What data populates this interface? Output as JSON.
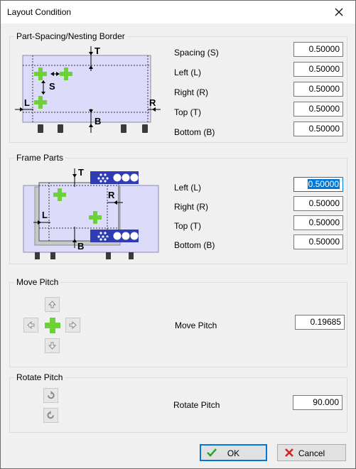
{
  "window": {
    "title": "Layout Condition"
  },
  "part_spacing": {
    "group_label": "Part-Spacing/Nesting Border",
    "fields": [
      {
        "label": "Spacing (S)",
        "value": "0.50000"
      },
      {
        "label": "Left (L)",
        "value": "0.50000"
      },
      {
        "label": "Right (R)",
        "value": "0.50000"
      },
      {
        "label": "Top (T)",
        "value": "0.50000"
      },
      {
        "label": "Bottom (B)",
        "value": "0.50000"
      }
    ],
    "diagram_labels": {
      "t": "T",
      "s": "S",
      "l": "L",
      "r": "R",
      "b": "B"
    }
  },
  "frame_parts": {
    "group_label": "Frame Parts",
    "fields": [
      {
        "label": "Left (L)",
        "value": "0.50000"
      },
      {
        "label": "Right (R)",
        "value": "0.50000"
      },
      {
        "label": "Top (T)",
        "value": "0.50000"
      },
      {
        "label": "Bottom (B)",
        "value": "0.50000"
      }
    ],
    "diagram_labels": {
      "t": "T",
      "l": "L",
      "r": "R",
      "b": "B"
    }
  },
  "move_pitch": {
    "group_label": "Move Pitch",
    "label": "Move Pitch",
    "value": "0.19685"
  },
  "rotate_pitch": {
    "group_label": "Rotate Pitch",
    "label": "Rotate Pitch",
    "value": "90.000"
  },
  "buttons": {
    "ok": "OK",
    "cancel": "Cancel"
  },
  "colors": {
    "plate": "#dcdcfa",
    "part": "#6fd13a",
    "accent": "#0078d7",
    "frame_blue": "#2f3cb4"
  }
}
